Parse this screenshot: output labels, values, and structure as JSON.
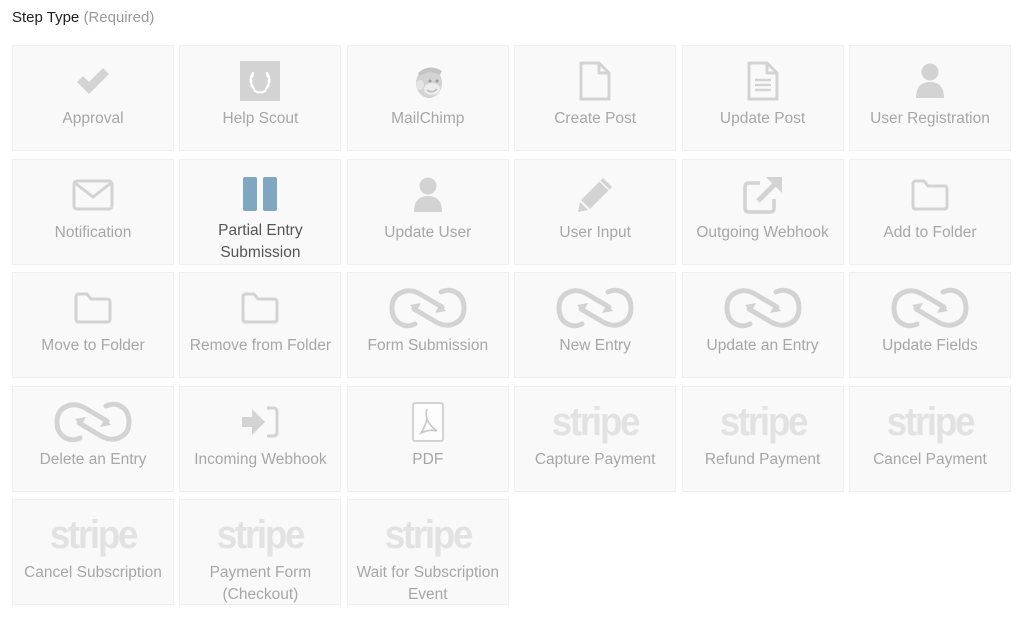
{
  "header": {
    "title": "Step Type",
    "required": "(Required)"
  },
  "colors": {
    "icon": "#d3d3d3",
    "selected_icon": "#7fa7c2",
    "label": "#a7a7a7",
    "selected_label": "#555555",
    "card_bg": "#f9f9f9"
  },
  "step_types": [
    {
      "label": "Approval",
      "icon": "checkmark-icon"
    },
    {
      "label": "Help Scout",
      "icon": "help-scout-icon"
    },
    {
      "label": "MailChimp",
      "icon": "mailchimp-icon"
    },
    {
      "label": "Create Post",
      "icon": "document-icon"
    },
    {
      "label": "Update Post",
      "icon": "document-text-icon"
    },
    {
      "label": "User Registration",
      "icon": "user-icon"
    },
    {
      "label": "Notification",
      "icon": "envelope-icon"
    },
    {
      "label": "Partial Entry Submission",
      "icon": "pause-icon",
      "selected": true
    },
    {
      "label": "Update User",
      "icon": "user-icon"
    },
    {
      "label": "User Input",
      "icon": "pencil-icon"
    },
    {
      "label": "Outgoing Webhook",
      "icon": "external-link-icon"
    },
    {
      "label": "Add to Folder",
      "icon": "folder-icon"
    },
    {
      "label": "Move to Folder",
      "icon": "folder-icon"
    },
    {
      "label": "Remove from Folder",
      "icon": "folder-icon"
    },
    {
      "label": "Form Submission",
      "icon": "infinity-connector-icon"
    },
    {
      "label": "New Entry",
      "icon": "infinity-connector-icon"
    },
    {
      "label": "Update an Entry",
      "icon": "infinity-connector-icon"
    },
    {
      "label": "Update Fields",
      "icon": "infinity-connector-icon"
    },
    {
      "label": "Delete an Entry",
      "icon": "infinity-connector-icon"
    },
    {
      "label": "Incoming Webhook",
      "icon": "sign-in-icon"
    },
    {
      "label": "PDF",
      "icon": "pdf-icon"
    },
    {
      "label": "Capture Payment",
      "icon": "stripe-icon"
    },
    {
      "label": "Refund Payment",
      "icon": "stripe-icon"
    },
    {
      "label": "Cancel Payment",
      "icon": "stripe-icon"
    },
    {
      "label": "Cancel Subscription",
      "icon": "stripe-icon"
    },
    {
      "label": "Payment Form (Checkout)",
      "icon": "stripe-icon"
    },
    {
      "label": "Wait for Subscription Event",
      "icon": "stripe-icon"
    }
  ],
  "stripe_wordmark": "stripe"
}
